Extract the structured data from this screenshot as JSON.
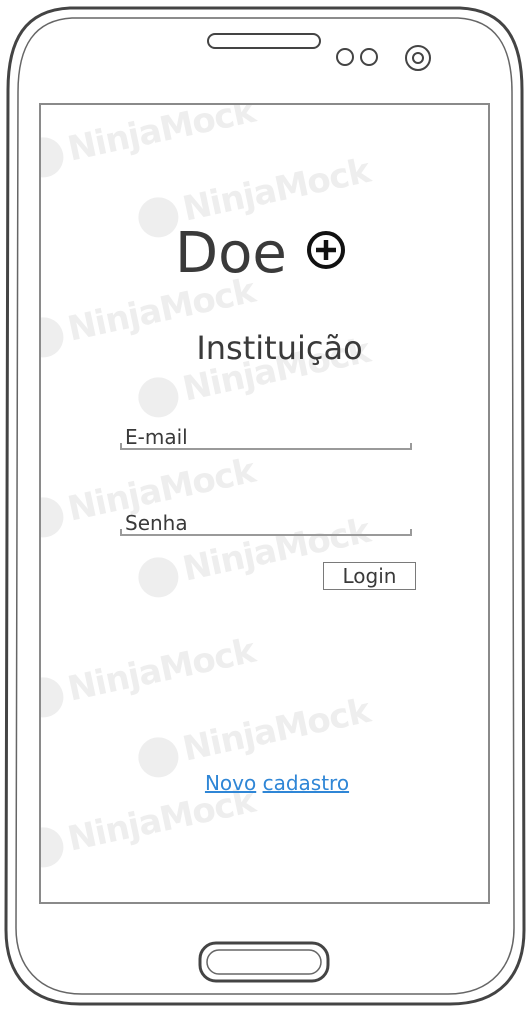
{
  "app": {
    "title": "Doe",
    "subtitle": "Instituição"
  },
  "login_form": {
    "email_placeholder": "E-mail",
    "password_placeholder": "Senha",
    "login_label": "Login"
  },
  "links": {
    "novo": "Novo",
    "cadastro": "cadastro"
  },
  "watermark": {
    "text": "NinjaMock"
  },
  "colors": {
    "text": "#3a3a3a",
    "link": "#2f86d6",
    "border": "#8a8a8a",
    "watermark": "#eeeeee"
  },
  "icons": {
    "plus": "circle-plus-icon"
  }
}
